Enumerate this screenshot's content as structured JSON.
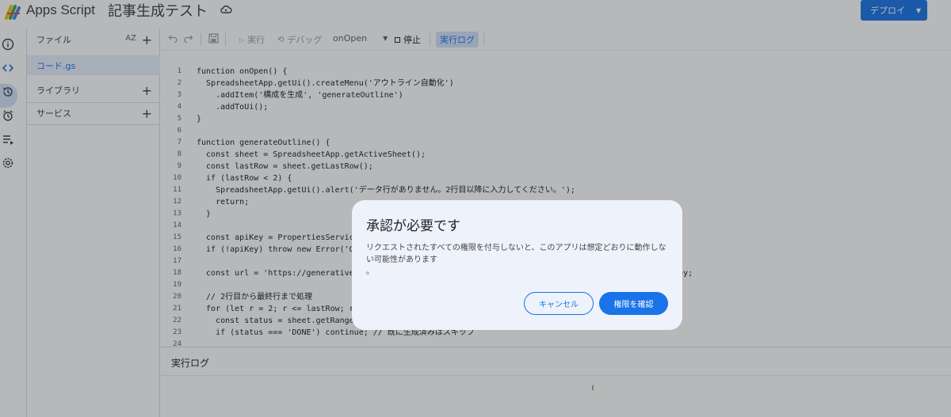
{
  "header": {
    "app_name": "Apps Script",
    "project_title": "記事生成テスト",
    "deploy_label": "デプロイ"
  },
  "sidebar": {
    "files_label": "ファイル",
    "sort_label": "AZ",
    "file_name": "コード.gs",
    "libraries_label": "ライブラリ",
    "services_label": "サービス"
  },
  "toolbar": {
    "run_label": "実行",
    "debug_label": "デバッグ",
    "function_select": "onOpen",
    "stop_label": "停止",
    "log_label": "実行ログ"
  },
  "code_lines": [
    {
      "n": "1",
      "text": "function onOpen() {"
    },
    {
      "n": "2",
      "text": "  SpreadsheetApp.getUi().createMenu('アウトライン自動化')"
    },
    {
      "n": "3",
      "text": "    .addItem('構成を生成', 'generateOutline')"
    },
    {
      "n": "4",
      "text": "    .addToUi();"
    },
    {
      "n": "5",
      "text": "}"
    },
    {
      "n": "6",
      "text": ""
    },
    {
      "n": "7",
      "text": "function generateOutline() {"
    },
    {
      "n": "8",
      "text": "  const sheet = SpreadsheetApp.getActiveSheet();"
    },
    {
      "n": "9",
      "text": "  const lastRow = sheet.getLastRow();"
    },
    {
      "n": "10",
      "text": "  if (lastRow < 2) {"
    },
    {
      "n": "11",
      "text": "    SpreadsheetApp.getUi().alert('データ行がありません。2行目以降に入力してください。');"
    },
    {
      "n": "12",
      "text": "    return;"
    },
    {
      "n": "13",
      "text": "  }"
    },
    {
      "n": "14",
      "text": ""
    },
    {
      "n": "15",
      "text": "  const apiKey = PropertiesService"
    },
    {
      "n": "16",
      "text": "  if (!apiKey) throw new Error('GE"
    },
    {
      "n": "17",
      "text": ""
    },
    {
      "n": "18",
      "text": "  const url = 'https://generativel                                                 ntent?key=' + apiKey;"
    },
    {
      "n": "19",
      "text": ""
    },
    {
      "n": "20",
      "text": "  // 2行目から最終行まで処理"
    },
    {
      "n": "21",
      "text": "  for (let r = 2; r <= lastRow; r+"
    },
    {
      "n": "22",
      "text": "    const status = sheet.getRange("
    },
    {
      "n": "23",
      "text": "    if (status === 'DONE') continue; // 既に生成済みはスキップ"
    },
    {
      "n": "24",
      "text": ""
    }
  ],
  "log_panel": {
    "title": "実行ログ"
  },
  "dialog": {
    "title": "承認が必要です",
    "body": "リクエストされたすべての権限を付与しないと、このアプリは想定どおりに動作しない可能性があります",
    "body_tail": "。",
    "cancel_label": "キャンセル",
    "confirm_label": "権限を確認"
  },
  "colors": {
    "accent": "#1a73e8",
    "dialog_bg": "#eef2fa",
    "overlay": "rgba(32,33,36,0.32)"
  }
}
